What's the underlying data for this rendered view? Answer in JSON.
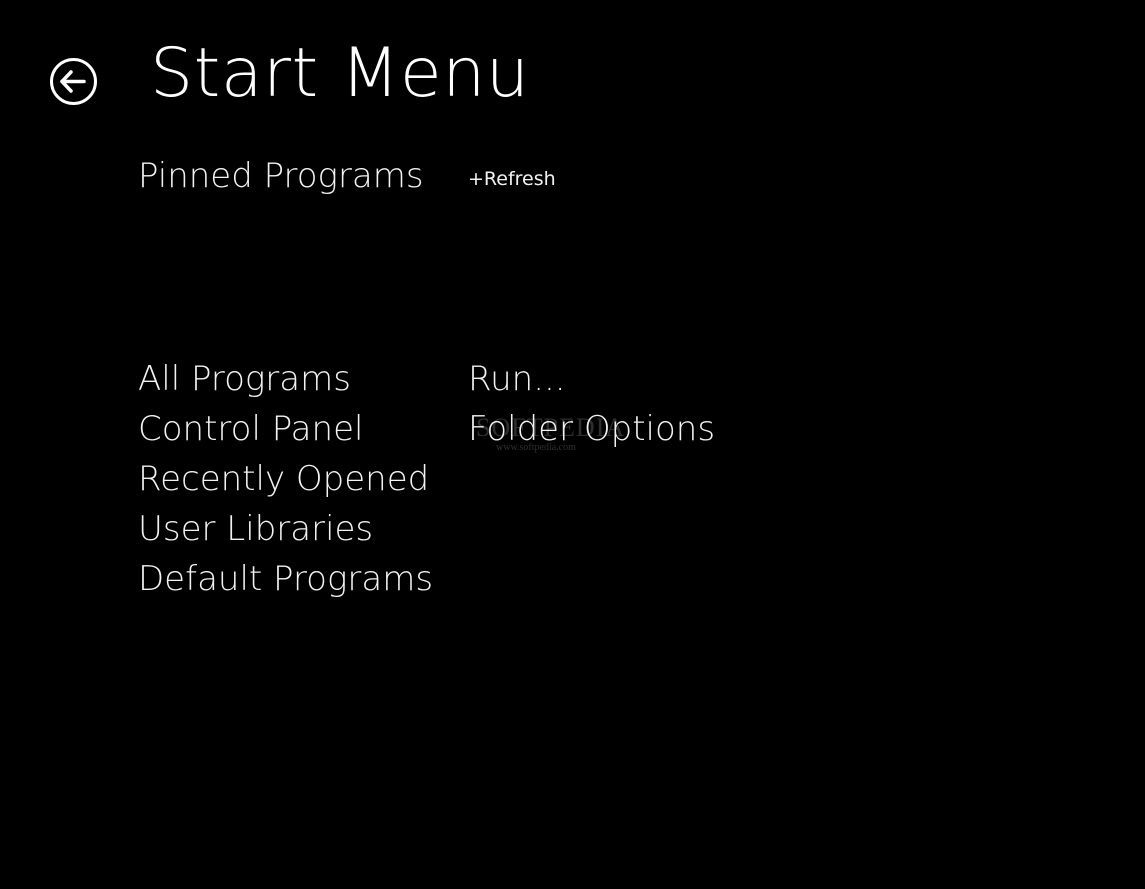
{
  "header": {
    "back_icon": "back-arrow-circle-icon",
    "title": "Start Menu"
  },
  "pinned": {
    "heading": "Pinned Programs",
    "refresh_label": "+Refresh"
  },
  "menu": {
    "left": [
      {
        "label": "All Programs"
      },
      {
        "label": "Control Panel"
      },
      {
        "label": "Recently Opened"
      },
      {
        "label": "User Libraries"
      },
      {
        "label": "Default Programs"
      }
    ],
    "right": [
      {
        "label": "Run..."
      },
      {
        "label": "Folder Options"
      }
    ]
  },
  "watermark": {
    "logo": "SOFTPEDIA",
    "url": "www.softpedia.com"
  },
  "colors": {
    "background": "#000000",
    "text": "#f2f2f2"
  }
}
